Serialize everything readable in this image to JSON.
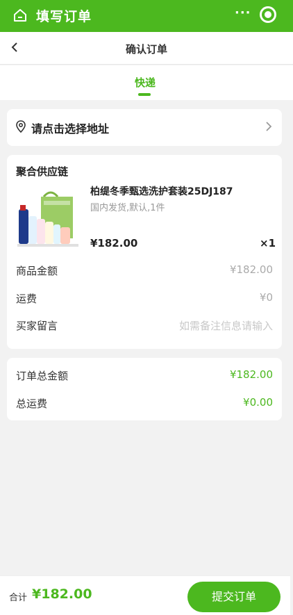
{
  "appbar": {
    "title": "填写订单",
    "more_label": "···",
    "home_icon": "home-icon",
    "target_icon": "target-icon",
    "color": "#4cb81f"
  },
  "navbar": {
    "title": "确认订单",
    "back_icon": "chevron-left-icon"
  },
  "tabs": [
    {
      "label": "快递",
      "active": true
    }
  ],
  "address": {
    "placeholder": "请点击选择地址",
    "icon": "location-pin-icon"
  },
  "order": {
    "store": "聚合供应链",
    "product": {
      "name": "柏缇冬季甄选洗护套装25DJ187",
      "spec": "国内发货,默认,1件",
      "price": "¥182.00",
      "qty": "×1"
    },
    "rows": [
      {
        "label": "商品金额",
        "value": "¥182.00"
      },
      {
        "label": "运费",
        "value": "¥0"
      },
      {
        "label": "买家留言",
        "placeholder": "如需备注信息请输入"
      }
    ]
  },
  "totals": [
    {
      "label": "订单总金额",
      "value": "¥182.00"
    },
    {
      "label": "总运费",
      "value": "¥0.00"
    }
  ],
  "bottom": {
    "sum_label": "合计",
    "sum_value": "¥182.00",
    "submit_label": "提交订单"
  }
}
